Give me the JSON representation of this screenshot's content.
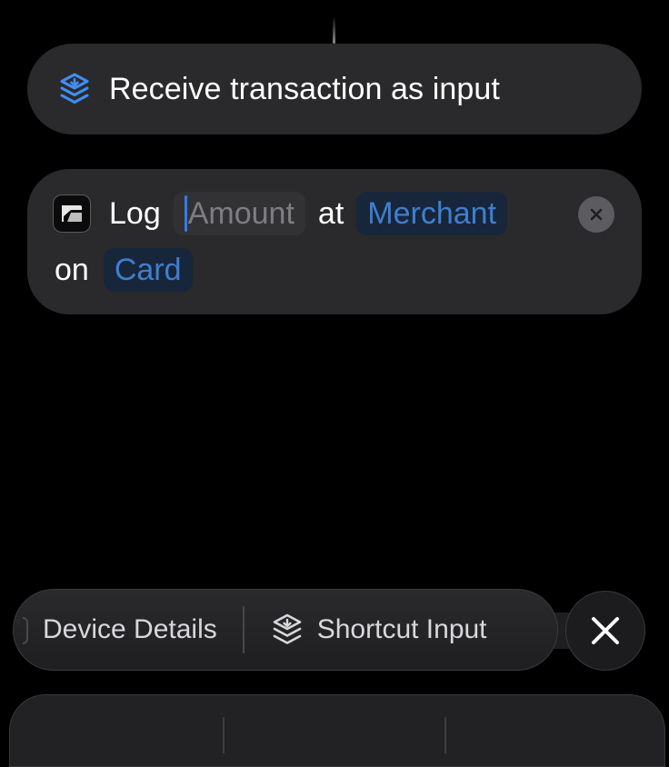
{
  "receive_card": {
    "title": "Receive transaction as input",
    "icon": "shortcut-input-icon"
  },
  "log_action": {
    "app_icon": "app-logo-icon",
    "word_log": "Log",
    "amount_placeholder": "Amount",
    "word_at": "at",
    "merchant_variable": "Merchant",
    "word_on": "on",
    "card_variable": "Card",
    "remove_icon": "remove-action-icon"
  },
  "suggestions": {
    "device_details": "Device Details",
    "shortcut_input": "Shortcut Input",
    "shortcut_icon": "shortcut-input-icon",
    "close_icon": "close-icon"
  },
  "colors": {
    "background": "#000000",
    "card": "#2a2a2c",
    "accent_blue": "#2f7bf5",
    "variable_text": "#3e7ed0",
    "variable_bg": "#17263a",
    "placeholder_text": "#7d7d82"
  }
}
